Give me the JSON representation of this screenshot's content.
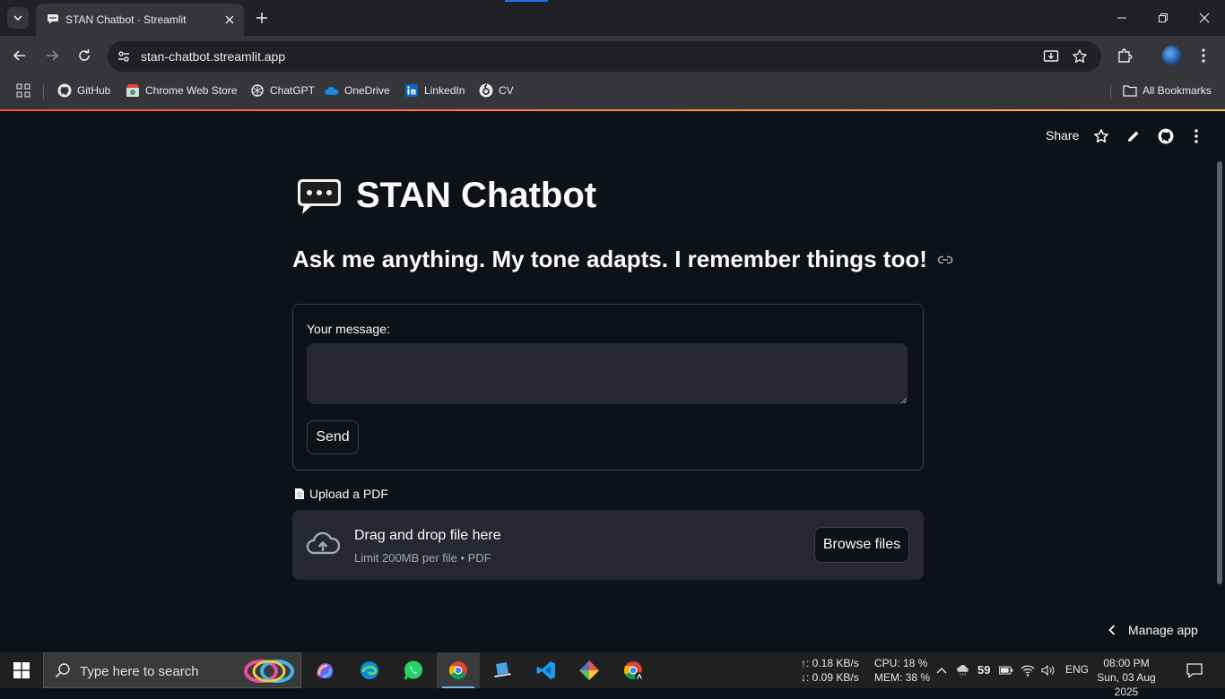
{
  "browser": {
    "tab_title": "STAN Chatbot · Streamlit",
    "url": "stan-chatbot.streamlit.app",
    "bookmarks": [
      {
        "label": "GitHub",
        "icon": "github-icon"
      },
      {
        "label": "Chrome Web Store",
        "icon": "chrome-web-store-icon"
      },
      {
        "label": "ChatGPT",
        "icon": "chatgpt-icon"
      },
      {
        "label": "OneDrive",
        "icon": "onedrive-icon"
      },
      {
        "label": "LinkedIn",
        "icon": "linkedin-icon"
      },
      {
        "label": "CV",
        "icon": "cv-icon"
      }
    ],
    "all_bookmarks": "All Bookmarks"
  },
  "header": {
    "share_label": "Share",
    "icons": [
      "star-icon",
      "pencil-icon",
      "github-icon",
      "more-vertical-icon"
    ]
  },
  "main": {
    "title": "STAN Chatbot",
    "title_emoji": "speech-bubble-icon",
    "subtitle": "Ask me anything. My tone adapts. I remember things too!",
    "form": {
      "message_label": "Your message:",
      "message_value": "",
      "send_label": "Send"
    },
    "upload": {
      "label": "Upload a PDF",
      "drop_title": "Drag and drop file here",
      "drop_limit": "Limit 200MB per file • PDF",
      "browse_label": "Browse files"
    },
    "manage_app": "Manage app"
  },
  "taskbar": {
    "search_placeholder": "Type here to search",
    "net_up": "↑: 0.18 KB/s",
    "net_down": "↓: 0.09 KB/s",
    "cpu": "CPU: 18 %",
    "mem": "MEM: 38 %",
    "temperature": "59",
    "language": "ENG",
    "time": "08:00 PM",
    "date": "Sun, 03 Aug 2025"
  },
  "colors": {
    "app_background": "#0e1117",
    "input_background": "#262730",
    "accent_stripe_start": "#ff4b4b",
    "accent_stripe_end": "#ffbd45"
  }
}
